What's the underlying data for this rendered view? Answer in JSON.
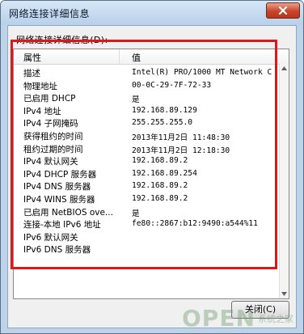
{
  "window": {
    "title": "网络连接详细信息",
    "group_label": "网络连接详细信息(D):",
    "close_button": "关闭(C)"
  },
  "table": {
    "columns": [
      "属性",
      "值"
    ],
    "rows": [
      {
        "property": "描述",
        "value": "Intel(R) PRO/1000 MT Network C"
      },
      {
        "property": "物理地址",
        "value": "00-0C-29-7F-72-33"
      },
      {
        "property": "已启用 DHCP",
        "value": "是"
      },
      {
        "property": "IPv4 地址",
        "value": "192.168.89.129"
      },
      {
        "property": "IPv4 子网掩码",
        "value": "255.255.255.0"
      },
      {
        "property": "获得租约的时间",
        "value": "2013年11月2日 11:48:30"
      },
      {
        "property": "租约过期的时间",
        "value": "2013年11月2日 12:18:30"
      },
      {
        "property": "IPv4 默认网关",
        "value": "192.168.89.2"
      },
      {
        "property": "IPv4 DHCP 服务器",
        "value": "192.168.89.254"
      },
      {
        "property": "IPv4 DNS 服务器",
        "value": "192.168.89.2"
      },
      {
        "property": "IPv4 WINS 服务器",
        "value": "192.168.89.2"
      },
      {
        "property": "已启用 NetBIOS ove...",
        "value": "是"
      },
      {
        "property": "连接-本地 IPv6 地址",
        "value": "fe80::2867:b12:9490:a544%11"
      },
      {
        "property": "IPv6 默认网关",
        "value": ""
      },
      {
        "property": "IPv6 DNS 服务器",
        "value": ""
      }
    ]
  },
  "watermark": {
    "text": "OPEN",
    "sub_text": "系统之家"
  },
  "colors": {
    "highlight_border": "#e4141b",
    "close_button": "#c9442a"
  },
  "icons": [
    "close-icon",
    "scroll-up-arrow-icon",
    "scroll-down-arrow-icon"
  ]
}
